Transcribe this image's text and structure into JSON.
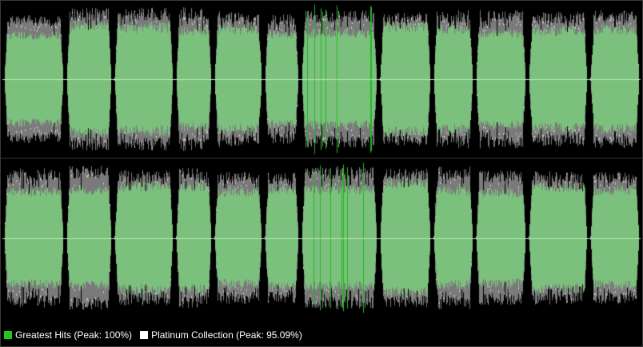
{
  "legend": {
    "items": [
      {
        "label": "Greatest Hits (Peak: 100%)",
        "color": "#22c422"
      },
      {
        "label": "Platinum Collection (Peak: 95.09%)",
        "color": "#ffffff"
      }
    ]
  },
  "colors": {
    "background": "#000000",
    "greatest_hits_fill": "#7cc07e",
    "greatest_hits_peak": "#22b822",
    "platinum_fill": "#7a7a7a",
    "platinum_peak": "#d8d8d8",
    "center_line": "#b6e6b6"
  },
  "waveform": {
    "channels": [
      "left",
      "right"
    ],
    "tracks": 13,
    "peak_greatest_hits_percent": 100,
    "peak_platinum_percent": 95.09
  }
}
